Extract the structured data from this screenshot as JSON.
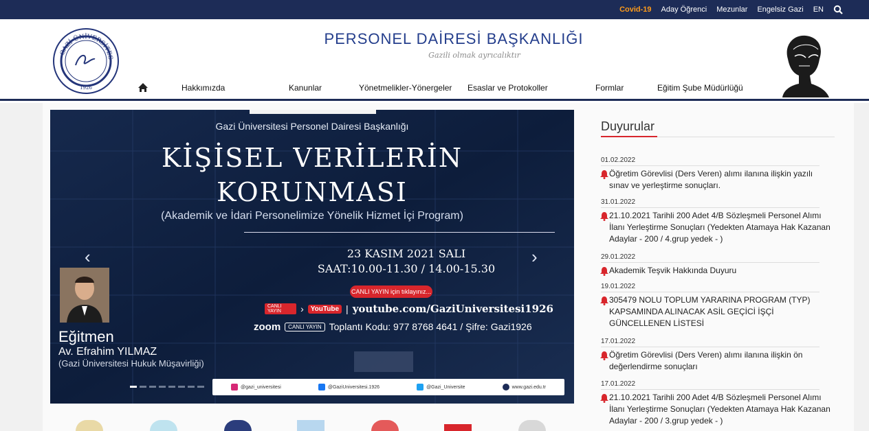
{
  "topbar": {
    "links": [
      {
        "label": "Covid-19",
        "name": "covid-link"
      },
      {
        "label": "Aday Öğrenci",
        "name": "aday-ogrenci-link"
      },
      {
        "label": "Mezunlar",
        "name": "mezunlar-link"
      },
      {
        "label": "Engelsiz Gazi",
        "name": "engelsiz-gazi-link"
      },
      {
        "label": "EN",
        "name": "language-en-link"
      }
    ],
    "search_icon": "search-icon"
  },
  "header": {
    "title": "PERSONEL DAİRESİ BAŞKANLIĞI",
    "slogan": "Gazili olmak ayrıcalıktır",
    "logo": {
      "top_text": "GAZİ ÜNİVERSİTESİ",
      "year": "1926"
    }
  },
  "nav": {
    "home_icon": "home-icon",
    "items": [
      "Hakkımızda",
      "Kanunlar",
      "Yönetmelikler-Yönergeler",
      "Esaslar ve Protokoller",
      "Formlar",
      "Eğitim Şube Müdürlüğü"
    ]
  },
  "slider": {
    "org": "Gazi Üniversitesi Personel Dairesi Başkanlığı",
    "headline_1": "KİŞİSEL VERİLERİN",
    "headline_2": "KORUNMASI",
    "subtitle": "(Akademik ve İdari Personelimize Yönelik Hizmet İçi Program)",
    "date": "23 KASIM 2021 SALI",
    "time": "SAAT:10.00-11.30 / 14.00-15.30",
    "live_button": "CANLI YAYIN için tıklayınız...",
    "live_tag": "CANLI YAYIN",
    "youtube_label": "YouTube",
    "youtube_url": "youtube.com/GaziUniversitesi1926",
    "zoom_label": "zoom",
    "zoom_tag": "CANLI YAYIN",
    "zoom_info": "Toplantı Kodu: 977 8768 4641 / Şifre: Gazi1926",
    "trainer_title": "Eğitmen",
    "trainer_name": "Av. Efrahim YILMAZ",
    "trainer_org": "(Gazi Üniversitesi Hukuk Müşavirliği)",
    "social": [
      {
        "label": "@gazi_universitesi",
        "color": "#d62976"
      },
      {
        "label": "@GaziUniversitesi.1926",
        "color": "#1877f2"
      },
      {
        "label": "@Gazi_Universite",
        "color": "#1da1f2"
      },
      {
        "label": "www.gazi.edu.tr",
        "color": "#1d2c57"
      }
    ],
    "active_dot": 0,
    "dot_count": 8
  },
  "notices": {
    "heading": "Duyurular",
    "items": [
      {
        "date": "01.02.2022",
        "text": "Öğretim Görevlisi (Ders Veren) alımı ilanına ilişkin yazılı sınav ve yerleştirme sonuçları."
      },
      {
        "date": "31.01.2022",
        "text": "21.10.2021 Tarihli 200 Adet 4/B Sözleşmeli Personel Alımı İlanı Yerleştirme Sonuçları (Yedekten Atamaya Hak Kazanan Adaylar - 200 / 4.grup yedek - )"
      },
      {
        "date": "29.01.2022",
        "text": "Akademik Teşvik Hakkında Duyuru"
      },
      {
        "date": "19.01.2022",
        "text": "305479 NOLU TOPLUM YARARINA PROGRAM (TYP) KAPSAMINDA ALINACAK ASİL GEÇİCİ İŞÇİ GÜNCELLENEN LİSTESİ"
      },
      {
        "date": "17.01.2022",
        "text": "Öğretim Görevlisi (Ders Veren) alımı ilanına ilişkin ön değerlendirme sonuçları"
      },
      {
        "date": "17.01.2022",
        "text": "21.10.2021 Tarihli 200 Adet 4/B Sözleşmeli Personel Alımı İlanı Yerleştirme Sonuçları (Yedekten Atamaya Hak Kazanan Adaylar - 200 / 3.grup yedek - )"
      }
    ]
  },
  "colors": {
    "navy": "#1d2c57",
    "title_blue": "#243e8c",
    "accent_red": "#d8262c",
    "covid_orange": "#ff9b1a"
  }
}
